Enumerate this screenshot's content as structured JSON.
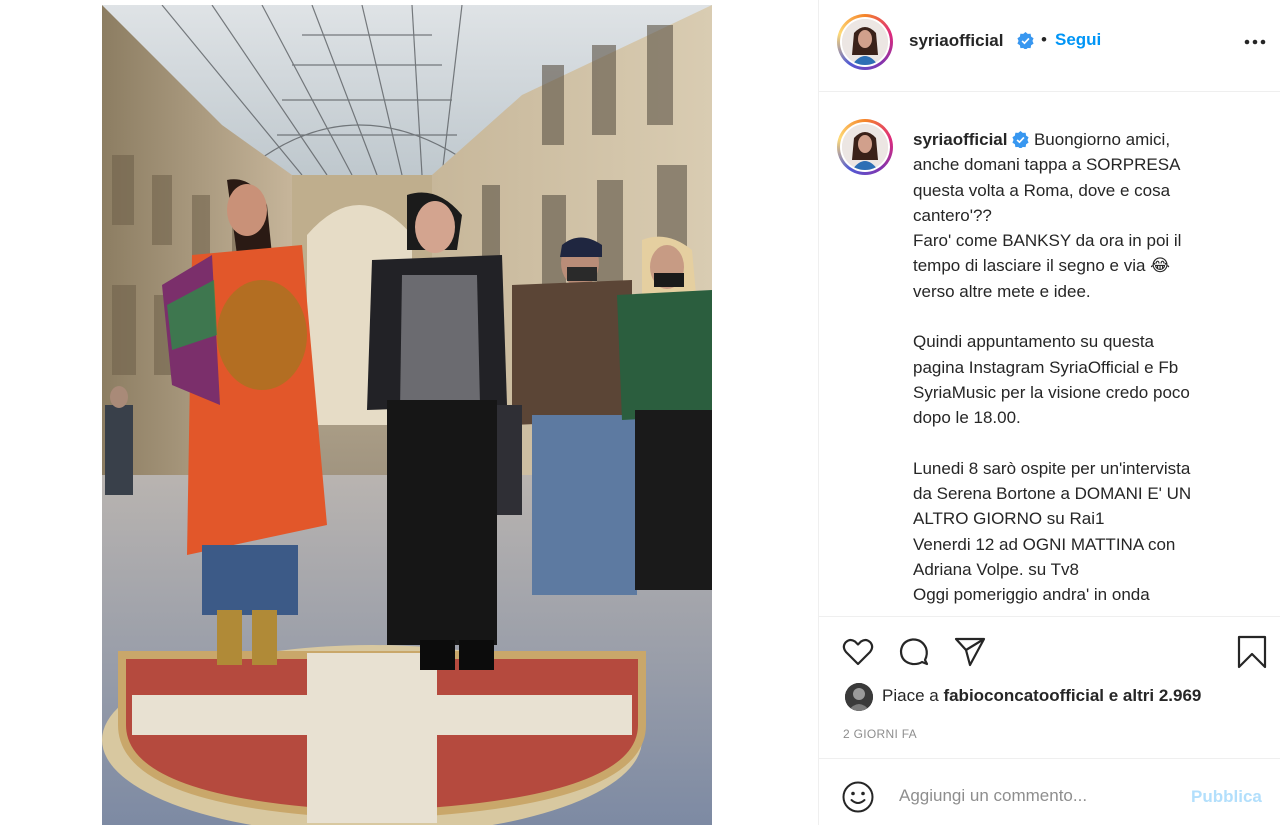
{
  "post": {
    "username": "syriaofficial",
    "verified_icon": "verified-badge-icon",
    "separator": "•",
    "follow_label": "Segui",
    "more_icon": "more-options-icon"
  },
  "caption": {
    "username": "syriaofficial",
    "text": "Buongiorno amici,\nanche domani tappa a SORPRESA\nquesta volta a Roma, dove e cosa\ncantero'??\nFaro' come BANKSY da ora in poi il\ntempo di lasciare il segno e via 😂\nverso altre mete e idee.\n\nQuindi appuntamento su questa\npagina Instagram SyriaOfficial e Fb\nSyriaMusic per la visione credo poco\ndopo le 18.00.\n\nLunedi 8 sarò ospite per un'intervista\nda Serena Bortone a DOMANI E' UN\nALTRO GIORNO su Rai1\nVenerdi 12 ad OGNI MATTINA con\nAdriana Volpe. su Tv8\nOggi pomeriggio andra' in onda"
  },
  "actions": {
    "like_icon": "heart-icon",
    "comment_icon": "comment-icon",
    "share_icon": "share-icon",
    "save_icon": "bookmark-icon"
  },
  "likes": {
    "prefix": "Piace a ",
    "user": "fabioconcatoofficial",
    "suffix": " e altri 2.969"
  },
  "timestamp": "2 GIORNI FA",
  "add_comment": {
    "emoji_icon": "emoji-icon",
    "placeholder": "Aggiungi un commento...",
    "publish_label": "Pubblica"
  },
  "colors": {
    "link_blue": "#0095f6",
    "publish_disabled": "#b2dffc",
    "verified_blue": "#3897f0",
    "coat_orange": "#e2572a"
  }
}
